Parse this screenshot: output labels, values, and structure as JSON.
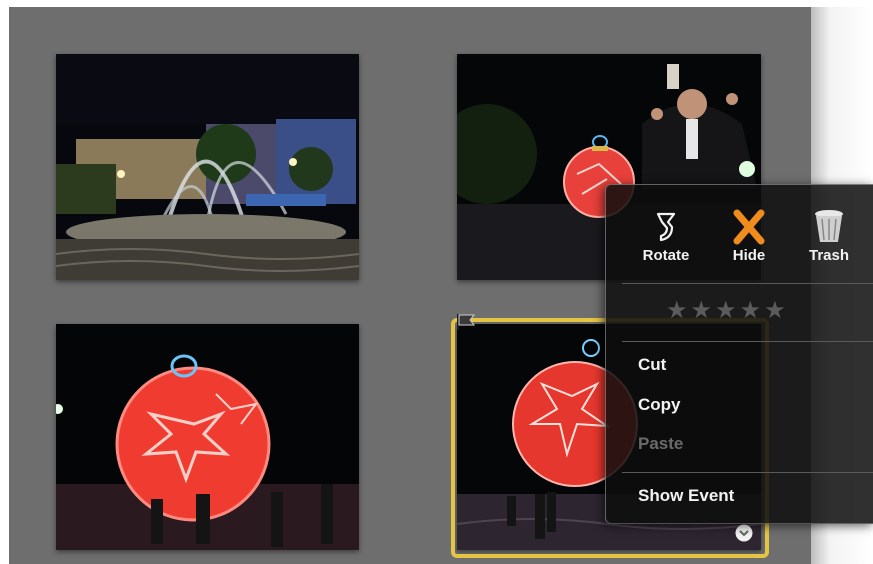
{
  "popup": {
    "actions": [
      {
        "label": "Rotate",
        "icon": "rotate-icon"
      },
      {
        "label": "Hide",
        "icon": "hide-x-icon",
        "color": "#f08c1e"
      },
      {
        "label": "Trash",
        "icon": "trash-icon"
      }
    ],
    "rating": {
      "stars": "★★★★★",
      "value": 0,
      "max": 5
    },
    "menu": [
      {
        "label": "Cut",
        "enabled": true
      },
      {
        "label": "Copy",
        "enabled": true
      },
      {
        "label": "Paste",
        "enabled": false
      },
      {
        "label": "Show Event",
        "enabled": true
      }
    ]
  },
  "photos": [
    {
      "subject": "night fountain square",
      "selected": false
    },
    {
      "subject": "person posing with lit ornament",
      "selected": false
    },
    {
      "subject": "giant red ornament blurred",
      "selected": false
    },
    {
      "subject": "giant red ornament close",
      "selected": true,
      "flagged": true
    }
  ],
  "colors": {
    "selection": "#e6c443",
    "hide_accent": "#f08c1e",
    "background": "#6e6e6e"
  }
}
